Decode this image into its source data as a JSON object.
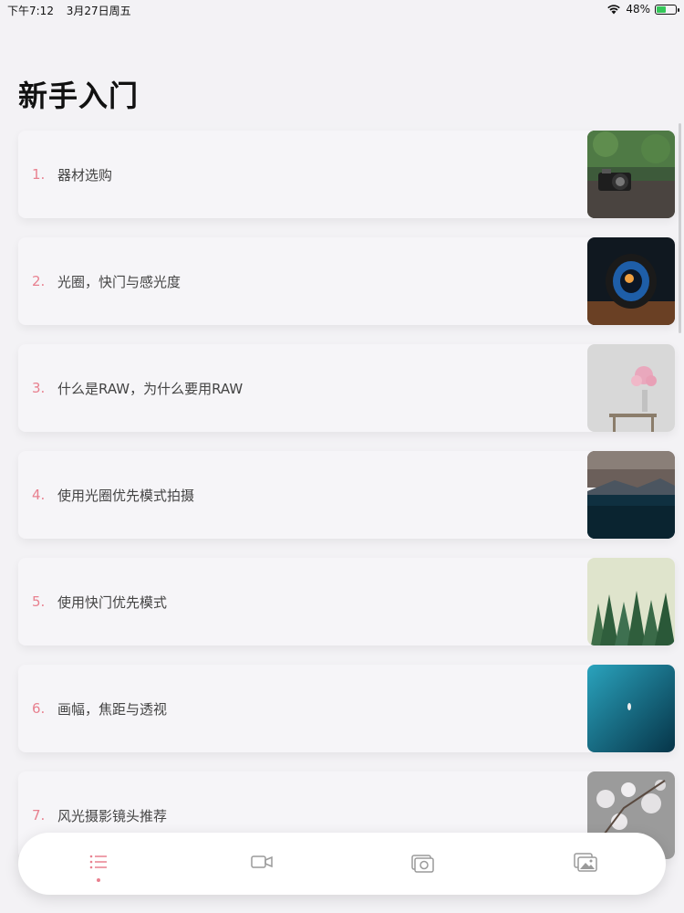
{
  "status_bar": {
    "time": "下午7:12",
    "date": "3月27日周五",
    "battery_percent": "48%",
    "battery_level": 0.48
  },
  "page": {
    "title": "新手入门"
  },
  "articles": [
    {
      "number": "1.",
      "title": "器材选购",
      "thumb_icon": "camera-photo"
    },
    {
      "number": "2.",
      "title": "光圈，快门与感光度",
      "thumb_icon": "lens-photo"
    },
    {
      "number": "3.",
      "title": "什么是RAW，为什么要用RAW",
      "thumb_icon": "flower-vase-photo"
    },
    {
      "number": "4.",
      "title": "使用光圈优先模式拍摄",
      "thumb_icon": "lake-mountain-photo"
    },
    {
      "number": "5.",
      "title": "使用快门优先模式",
      "thumb_icon": "forest-photo"
    },
    {
      "number": "6.",
      "title": "画幅，焦距与透视",
      "thumb_icon": "aerial-boat-photo"
    },
    {
      "number": "7.",
      "title": "风光摄影镜头推荐",
      "thumb_icon": "blossom-photo"
    }
  ],
  "tab_bar": {
    "tabs": [
      "list-icon",
      "video-icon",
      "camera-icon",
      "gallery-icon"
    ],
    "active_index": 0,
    "accent_color": "#e8808f"
  },
  "colors": {
    "accent": "#e8808f",
    "background": "#f3f2f5"
  }
}
